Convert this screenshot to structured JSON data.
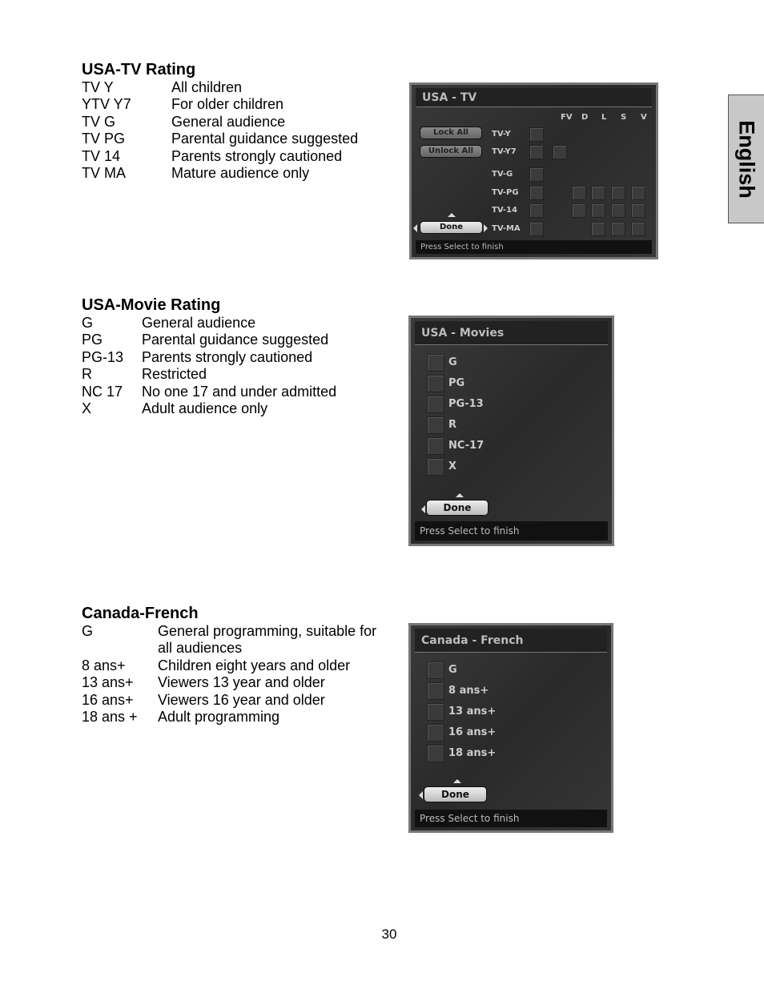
{
  "side_tab": "English",
  "page_number": "30",
  "sections": [
    {
      "heading": "USA-TV Rating",
      "rows": [
        [
          "TV Y",
          "All children"
        ],
        [
          "YTV Y7",
          "For older children"
        ],
        [
          "TV G",
          "General audience"
        ],
        [
          "TV PG",
          "Parental guidance suggested"
        ],
        [
          "TV 14",
          "Parents strongly cautioned"
        ],
        [
          "TV MA",
          "Mature audience only"
        ]
      ]
    },
    {
      "heading": "USA-Movie Rating",
      "rows": [
        [
          "G",
          "General audience"
        ],
        [
          "PG",
          "Parental guidance suggested"
        ],
        [
          "PG-13",
          "Parents strongly cautioned"
        ],
        [
          "R",
          "Restricted"
        ],
        [
          "NC 17",
          "No one 17 and under admitted"
        ],
        [
          "X",
          "Adult audience only"
        ]
      ]
    },
    {
      "heading": "Canada-French",
      "rows": [
        [
          "G",
          "General programming, suitable for all audiences"
        ],
        [
          "8 ans+",
          "Children eight years and older"
        ],
        [
          "13 ans+",
          "Viewers 13 year and older"
        ],
        [
          "16 ans+",
          "Viewers 16 year and older"
        ],
        [
          "18 ans +",
          "Adult programming"
        ]
      ]
    }
  ],
  "screens": {
    "usa_tv": {
      "title": "USA - TV",
      "columns": [
        "FV",
        "D",
        "L",
        "S",
        "V"
      ],
      "ratings": [
        "TV-Y",
        "TV-Y7",
        "TV-G",
        "TV-PG",
        "TV-14",
        "TV-MA"
      ],
      "lock_all": "Lock All",
      "unlock_all": "Unlock All",
      "done": "Done",
      "status": "Press Select to finish"
    },
    "usa_movies": {
      "title": "USA - Movies",
      "ratings": [
        "G",
        "PG",
        "PG-13",
        "R",
        "NC-17",
        "X"
      ],
      "done": "Done",
      "status": "Press Select to finish"
    },
    "canada_french": {
      "title": "Canada - French",
      "ratings": [
        "G",
        "8 ans+",
        "13 ans+",
        "16 ans+",
        "18 ans+"
      ],
      "done": "Done",
      "status": "Press Select to finish"
    }
  }
}
